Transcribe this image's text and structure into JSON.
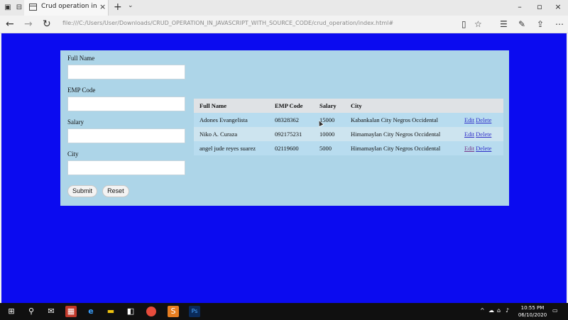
{
  "browser": {
    "tab_title": "Crud operation in javasc",
    "close_glyph": "×",
    "newtab_glyph": "+",
    "chevron_glyph": "⌄",
    "url": "file:///C:/Users/User/Downloads/CRUD_OPERATION_IN_JAVASCRIPT_WITH_SOURCE_CODE/crud_operation/index.html#",
    "window_controls": [
      "–",
      "▫",
      "×"
    ],
    "nav_glyphs": {
      "back": "←",
      "forward": "→",
      "refresh": "↻"
    },
    "right_glyphs": [
      "▯",
      "☆",
      "☰",
      "✎",
      "⇪",
      "⋯"
    ]
  },
  "form": {
    "labels": {
      "full_name": "Full Name",
      "emp_code": "EMP Code",
      "salary": "Salary",
      "city": "City"
    },
    "values": {
      "full_name": "",
      "emp_code": "",
      "salary": "",
      "city": ""
    },
    "submit_label": "Submit",
    "reset_label": "Reset"
  },
  "table": {
    "headers": [
      "Full Name",
      "EMP Code",
      "Salary",
      "City"
    ],
    "rows": [
      {
        "name": "Adones Evangelista",
        "code": "08328362",
        "salary": "15000",
        "city": "Kabankalan City Negros Occidental",
        "edit": "Edit",
        "delete": "Delete"
      },
      {
        "name": "Niko A. Curaza",
        "code": "092175231",
        "salary": "10000",
        "city": "Himamaylan City Negros Occidental",
        "edit": "Edit",
        "delete": "Delete"
      },
      {
        "name": "angel jude reyes suarez",
        "code": "02119600",
        "salary": "5000",
        "city": "Himamaylan City Negros Occidental",
        "edit": "Edit",
        "delete": "Delete"
      }
    ]
  },
  "taskbar": {
    "time": "10:55 PM",
    "date": "06/10/2020",
    "tray_arrow": "^",
    "apps": [
      "windows-icon",
      "search-icon",
      "mail-icon",
      "store-gift-icon",
      "edge-icon",
      "file-explorer-icon",
      "store-icon",
      "chrome-icon",
      "sublime-icon",
      "photoshop-icon"
    ],
    "photoshop_label": "Ps"
  },
  "colors": {
    "page_bg": "#0b0bf0",
    "card_bg": "#add5e8",
    "header_bg": "#dfe2e5",
    "link": "#3030c8"
  }
}
